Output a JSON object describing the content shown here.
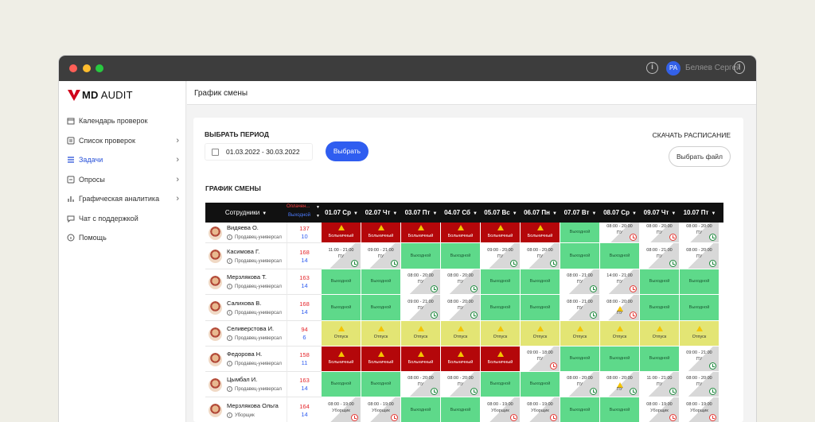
{
  "window": {
    "user_initials": "PA",
    "user_name": "Беляев Сергей"
  },
  "logo": {
    "bold": "MD",
    "light": " AUDIT"
  },
  "sidebar": {
    "items": [
      {
        "label": "Календарь проверок",
        "icon": "calendar-icon",
        "chevron": false,
        "active": false
      },
      {
        "label": "Список проверок",
        "icon": "list-icon",
        "chevron": true,
        "active": false
      },
      {
        "label": "Задачи",
        "icon": "tasks-icon",
        "chevron": true,
        "active": true
      },
      {
        "label": "Опросы",
        "icon": "survey-icon",
        "chevron": true,
        "active": false
      },
      {
        "label": "Графическая аналитика",
        "icon": "analytics-icon",
        "chevron": true,
        "active": false
      },
      {
        "label": "Чат с поддержкой",
        "icon": "chat-icon",
        "chevron": false,
        "active": false
      },
      {
        "label": "Помощь",
        "icon": "help-icon",
        "chevron": false,
        "active": false
      }
    ]
  },
  "page": {
    "title": "График смены"
  },
  "period": {
    "label": "ВЫБРАТЬ ПЕРИОД",
    "range": "01.03.2022 - 30.03.2022",
    "choose_button": "Выбрать"
  },
  "download": {
    "label": "СКАЧАТЬ РАСПИСАНИЕ",
    "file_button": "Выбрать файл"
  },
  "schedule": {
    "label": "ГРАФИК СМЕНЫ",
    "header": {
      "employees": "Сотрудники",
      "paid": "Оплачен...",
      "off": "Выходной"
    },
    "days": [
      "01.07 Ср",
      "02.07 Чт",
      "03.07 Пт",
      "04.07 Сб",
      "05.07 Вс",
      "06.07 Пн",
      "07.07 Вт",
      "08.07 Ср",
      "09.07 Чт",
      "10.07 Пт"
    ],
    "colors": {
      "sick": "#b4070a",
      "dayoff": "#5ed98a",
      "vacation": "#e3e574",
      "shift": "#d8d8d8"
    },
    "rows": [
      {
        "name": "Видяева О.",
        "role": "Продавец-универсал",
        "paid": "137",
        "off": "10",
        "cells": [
          {
            "type": "red",
            "text": "Больничный",
            "warn": true
          },
          {
            "type": "red",
            "text": "Больничный",
            "warn": true
          },
          {
            "type": "red",
            "text": "Больничный",
            "warn": true
          },
          {
            "type": "red",
            "text": "Больничный",
            "warn": true
          },
          {
            "type": "red",
            "text": "Больничный",
            "warn": true
          },
          {
            "type": "red",
            "text": "Больничный",
            "warn": true
          },
          {
            "type": "green",
            "text": "Выходной"
          },
          {
            "type": "gray",
            "text": "08:00 - 20:00",
            "sub": "ПУ",
            "clock": "red"
          },
          {
            "type": "gray",
            "text": "08:00 - 20:00",
            "sub": "ПУ",
            "clock": "red"
          },
          {
            "type": "gray",
            "text": "08:00 - 20:00",
            "sub": "ПУ",
            "clock": "green"
          }
        ]
      },
      {
        "name": "Касимова Г.",
        "role": "Продавец-универсал",
        "paid": "168",
        "off": "14",
        "cells": [
          {
            "type": "gray",
            "text": "11:00 - 21:00",
            "sub": "ПУ",
            "clock": "green"
          },
          {
            "type": "gray",
            "text": "09:00 - 21:00",
            "sub": "ПУ",
            "clock": "green"
          },
          {
            "type": "green",
            "text": "Выходной"
          },
          {
            "type": "green",
            "text": "Выходной"
          },
          {
            "type": "gray",
            "text": "09:00 - 20:00",
            "sub": "ПУ",
            "clock": "green"
          },
          {
            "type": "gray",
            "text": "08:00 - 20:00",
            "sub": "ПУ",
            "clock": "green"
          },
          {
            "type": "green",
            "text": "Выходной"
          },
          {
            "type": "green",
            "text": "Выходной"
          },
          {
            "type": "gray",
            "text": "08:00 - 21:00",
            "sub": "ПУ",
            "clock": "green"
          },
          {
            "type": "gray",
            "text": "08:00 - 20:00",
            "sub": "ПУ",
            "clock": "green"
          }
        ]
      },
      {
        "name": "Мерзлякова Т.",
        "role": "Продавец-универсал",
        "paid": "163",
        "off": "14",
        "cells": [
          {
            "type": "green",
            "text": "Выходной"
          },
          {
            "type": "green",
            "text": "Выходной"
          },
          {
            "type": "gray",
            "text": "08:00 - 20:00",
            "sub": "ПУ",
            "clock": "green"
          },
          {
            "type": "gray",
            "text": "08:00 - 20:00",
            "sub": "ПУ",
            "clock": "green"
          },
          {
            "type": "green",
            "text": "Выходной"
          },
          {
            "type": "green",
            "text": "Выходной"
          },
          {
            "type": "gray",
            "text": "08:00 - 21:00",
            "sub": "ПУ",
            "clock": "green"
          },
          {
            "type": "gray",
            "text": "14:00 - 21:00",
            "sub": "ПУ",
            "clock": "red"
          },
          {
            "type": "green",
            "text": "Выходной"
          },
          {
            "type": "green",
            "text": "Выходной"
          }
        ]
      },
      {
        "name": "Салихова В.",
        "role": "Продавец-универсал",
        "paid": "168",
        "off": "14",
        "cells": [
          {
            "type": "green",
            "text": "Выходной"
          },
          {
            "type": "green",
            "text": "Выходной"
          },
          {
            "type": "gray",
            "text": "09:00 - 21:00",
            "sub": "ПУ",
            "clock": "green"
          },
          {
            "type": "gray",
            "text": "08:00 - 20:00",
            "sub": "ПУ",
            "clock": "green"
          },
          {
            "type": "green",
            "text": "Выходной"
          },
          {
            "type": "green",
            "text": "Выходной"
          },
          {
            "type": "gray",
            "text": "08:00 - 21:00",
            "sub": "ПУ",
            "clock": "green"
          },
          {
            "type": "gray",
            "text": "08:00 - 20:00",
            "sub": "ПУ",
            "clock": "red",
            "warn": true
          },
          {
            "type": "green",
            "text": "Выходной"
          },
          {
            "type": "green",
            "text": "Выходной"
          }
        ]
      },
      {
        "name": "Селиверстова И.",
        "role": "Продавец-универсал",
        "paid": "94",
        "off": "6",
        "cells": [
          {
            "type": "yellow",
            "text": "Отпуск",
            "warn": true
          },
          {
            "type": "yellow",
            "text": "Отпуск",
            "warn": true
          },
          {
            "type": "yellow",
            "text": "Отпуск",
            "warn": true
          },
          {
            "type": "yellow",
            "text": "Отпуск",
            "warn": true
          },
          {
            "type": "yellow",
            "text": "Отпуск",
            "warn": true
          },
          {
            "type": "yellow",
            "text": "Отпуск",
            "warn": true
          },
          {
            "type": "yellow",
            "text": "Отпуск",
            "warn": true
          },
          {
            "type": "yellow",
            "text": "Отпуск",
            "warn": true
          },
          {
            "type": "yellow",
            "text": "Отпуск",
            "warn": true
          },
          {
            "type": "yellow",
            "text": "Отпуск",
            "warn": true
          }
        ]
      },
      {
        "name": "Федорова Н.",
        "role": "Продавец-универсал",
        "paid": "158",
        "off": "11",
        "cells": [
          {
            "type": "red",
            "text": "Больничный",
            "warn": true
          },
          {
            "type": "red",
            "text": "Больничный",
            "warn": true
          },
          {
            "type": "red",
            "text": "Больничный",
            "warn": true
          },
          {
            "type": "red",
            "text": "Больничный",
            "warn": true
          },
          {
            "type": "red",
            "text": "Больничный",
            "warn": true
          },
          {
            "type": "gray",
            "text": "09:00 - 18:00",
            "sub": "ПУ",
            "clock": "red"
          },
          {
            "type": "green",
            "text": "Выходной"
          },
          {
            "type": "green",
            "text": "Выходной"
          },
          {
            "type": "green",
            "text": "Выходной"
          },
          {
            "type": "gray",
            "text": "09:00 - 21:00",
            "sub": "ПУ",
            "clock": "green"
          }
        ]
      },
      {
        "name": "Цымбал И.",
        "role": "Продавец-универсал",
        "paid": "163",
        "off": "14",
        "cells": [
          {
            "type": "green",
            "text": "Выходной"
          },
          {
            "type": "green",
            "text": "Выходной"
          },
          {
            "type": "gray",
            "text": "08:00 - 20:00",
            "sub": "ПУ",
            "clock": "green"
          },
          {
            "type": "gray",
            "text": "08:00 - 20:00",
            "sub": "ПУ",
            "clock": "green"
          },
          {
            "type": "green",
            "text": "Выходной"
          },
          {
            "type": "green",
            "text": "Выходной"
          },
          {
            "type": "gray",
            "text": "08:00 - 20:00",
            "sub": "ПУ",
            "clock": "green"
          },
          {
            "type": "gray",
            "text": "08:00 - 20:00",
            "sub": "ПУ",
            "clock": "green",
            "warn": true
          },
          {
            "type": "gray",
            "text": "11:00 - 21:00",
            "sub": "ПУ",
            "clock": "green"
          },
          {
            "type": "gray",
            "text": "08:00 - 20:00",
            "sub": "ПУ",
            "clock": "green"
          }
        ]
      },
      {
        "name": "Мерзлякова Ольга",
        "role": "Уборщик",
        "paid": "164",
        "off": "14",
        "cells": [
          {
            "type": "gray",
            "text": "08:00 - 19:00",
            "sub": "Уборщик",
            "clock": "red"
          },
          {
            "type": "gray",
            "text": "08:00 - 19:00",
            "sub": "Уборщик",
            "clock": "red"
          },
          {
            "type": "green",
            "text": "Выходной"
          },
          {
            "type": "green",
            "text": "Выходной"
          },
          {
            "type": "gray",
            "text": "08:00 - 19:00",
            "sub": "Уборщик",
            "clock": "red"
          },
          {
            "type": "gray",
            "text": "08:00 - 19:00",
            "sub": "Уборщик",
            "clock": "red"
          },
          {
            "type": "green",
            "text": "Выходной"
          },
          {
            "type": "green",
            "text": "Выходной"
          },
          {
            "type": "gray",
            "text": "08:00 - 19:00",
            "sub": "Уборщик",
            "clock": "red"
          },
          {
            "type": "gray",
            "text": "08:00 - 19:00",
            "sub": "Уборщик",
            "clock": "red"
          }
        ]
      }
    ]
  }
}
